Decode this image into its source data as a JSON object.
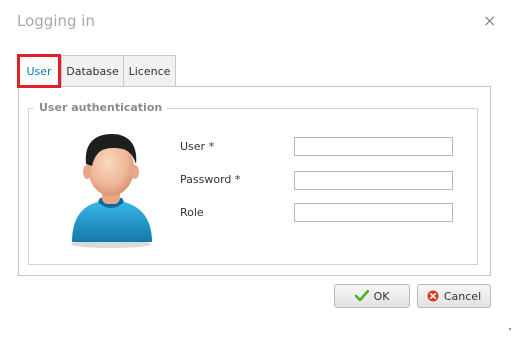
{
  "dialog": {
    "title": "Logging in",
    "close_glyph": "×"
  },
  "tabs": [
    {
      "label": "User",
      "active": true
    },
    {
      "label": "Database",
      "active": false
    },
    {
      "label": "Licence",
      "active": false
    }
  ],
  "auth": {
    "legend": "User authentication",
    "avatar_icon": "user-avatar-icon",
    "fields": [
      {
        "label": "User *",
        "value": "",
        "placeholder": ""
      },
      {
        "label": "Password *",
        "value": "",
        "placeholder": ""
      },
      {
        "label": "Role",
        "value": "",
        "placeholder": ""
      }
    ]
  },
  "buttons": {
    "ok": {
      "label": "OK",
      "icon": "checkmark-icon"
    },
    "cancel": {
      "label": "Cancel",
      "icon": "cancel-x-icon"
    }
  },
  "colors": {
    "active_tab_border": "#e0202d",
    "active_tab_text": "#0a7cbf",
    "ok_icon": "#4caf26",
    "cancel_icon": "#d8392b"
  }
}
